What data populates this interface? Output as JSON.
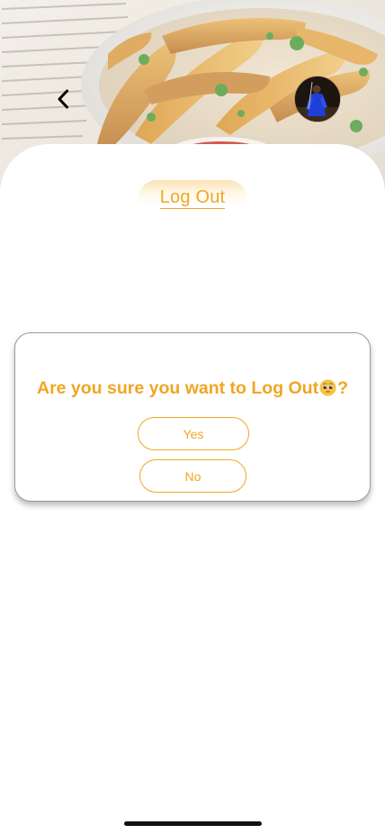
{
  "header": {
    "back_icon": "chevron-left-icon",
    "avatar_icon": "user-avatar"
  },
  "page": {
    "title": "Log Out"
  },
  "dialog": {
    "question_prefix": "Are you sure you want to Log Out",
    "question_emoji": "pleading-face-emoji",
    "question_suffix": "?",
    "yes_label": "Yes",
    "no_label": "No"
  },
  "colors": {
    "accent": "#f0a623",
    "dialog_border": "#9a9a9a",
    "background": "#ffffff"
  }
}
